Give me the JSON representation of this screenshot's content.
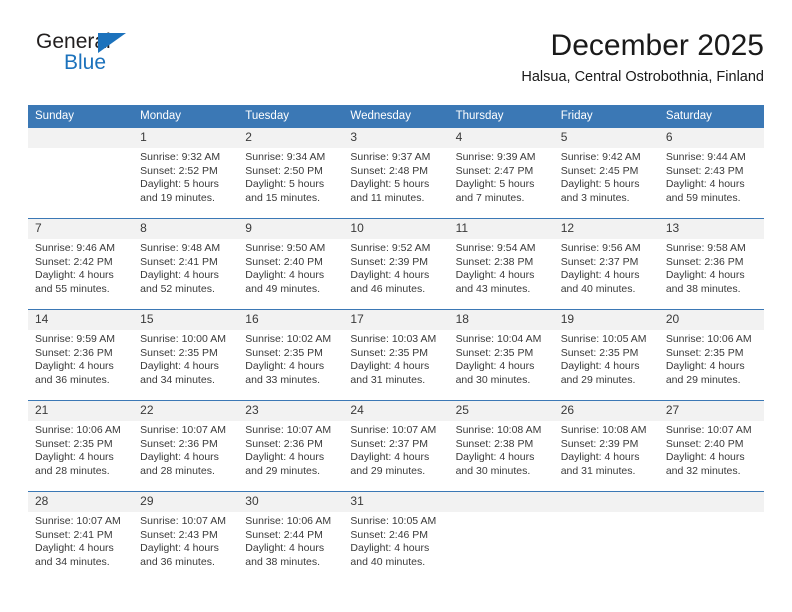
{
  "brand": {
    "name_top": "General",
    "name_bottom": "Blue",
    "triangle_color": "#1c72bc"
  },
  "header": {
    "title": "December 2025",
    "subtitle": "Halsua, Central Ostrobothnia, Finland"
  },
  "theme": {
    "header_bg": "#3b78b5",
    "daynum_bg": "#f2f2f2",
    "text": "#3a3a3a"
  },
  "calendar": {
    "weekday_headers": [
      "Sunday",
      "Monday",
      "Tuesday",
      "Wednesday",
      "Thursday",
      "Friday",
      "Saturday"
    ],
    "weeks": [
      [
        {
          "day": "",
          "lines": []
        },
        {
          "day": "1",
          "lines": [
            "Sunrise: 9:32 AM",
            "Sunset: 2:52 PM",
            "Daylight: 5 hours",
            "and 19 minutes."
          ]
        },
        {
          "day": "2",
          "lines": [
            "Sunrise: 9:34 AM",
            "Sunset: 2:50 PM",
            "Daylight: 5 hours",
            "and 15 minutes."
          ]
        },
        {
          "day": "3",
          "lines": [
            "Sunrise: 9:37 AM",
            "Sunset: 2:48 PM",
            "Daylight: 5 hours",
            "and 11 minutes."
          ]
        },
        {
          "day": "4",
          "lines": [
            "Sunrise: 9:39 AM",
            "Sunset: 2:47 PM",
            "Daylight: 5 hours",
            "and 7 minutes."
          ]
        },
        {
          "day": "5",
          "lines": [
            "Sunrise: 9:42 AM",
            "Sunset: 2:45 PM",
            "Daylight: 5 hours",
            "and 3 minutes."
          ]
        },
        {
          "day": "6",
          "lines": [
            "Sunrise: 9:44 AM",
            "Sunset: 2:43 PM",
            "Daylight: 4 hours",
            "and 59 minutes."
          ]
        }
      ],
      [
        {
          "day": "7",
          "lines": [
            "Sunrise: 9:46 AM",
            "Sunset: 2:42 PM",
            "Daylight: 4 hours",
            "and 55 minutes."
          ]
        },
        {
          "day": "8",
          "lines": [
            "Sunrise: 9:48 AM",
            "Sunset: 2:41 PM",
            "Daylight: 4 hours",
            "and 52 minutes."
          ]
        },
        {
          "day": "9",
          "lines": [
            "Sunrise: 9:50 AM",
            "Sunset: 2:40 PM",
            "Daylight: 4 hours",
            "and 49 minutes."
          ]
        },
        {
          "day": "10",
          "lines": [
            "Sunrise: 9:52 AM",
            "Sunset: 2:39 PM",
            "Daylight: 4 hours",
            "and 46 minutes."
          ]
        },
        {
          "day": "11",
          "lines": [
            "Sunrise: 9:54 AM",
            "Sunset: 2:38 PM",
            "Daylight: 4 hours",
            "and 43 minutes."
          ]
        },
        {
          "day": "12",
          "lines": [
            "Sunrise: 9:56 AM",
            "Sunset: 2:37 PM",
            "Daylight: 4 hours",
            "and 40 minutes."
          ]
        },
        {
          "day": "13",
          "lines": [
            "Sunrise: 9:58 AM",
            "Sunset: 2:36 PM",
            "Daylight: 4 hours",
            "and 38 minutes."
          ]
        }
      ],
      [
        {
          "day": "14",
          "lines": [
            "Sunrise: 9:59 AM",
            "Sunset: 2:36 PM",
            "Daylight: 4 hours",
            "and 36 minutes."
          ]
        },
        {
          "day": "15",
          "lines": [
            "Sunrise: 10:00 AM",
            "Sunset: 2:35 PM",
            "Daylight: 4 hours",
            "and 34 minutes."
          ]
        },
        {
          "day": "16",
          "lines": [
            "Sunrise: 10:02 AM",
            "Sunset: 2:35 PM",
            "Daylight: 4 hours",
            "and 33 minutes."
          ]
        },
        {
          "day": "17",
          "lines": [
            "Sunrise: 10:03 AM",
            "Sunset: 2:35 PM",
            "Daylight: 4 hours",
            "and 31 minutes."
          ]
        },
        {
          "day": "18",
          "lines": [
            "Sunrise: 10:04 AM",
            "Sunset: 2:35 PM",
            "Daylight: 4 hours",
            "and 30 minutes."
          ]
        },
        {
          "day": "19",
          "lines": [
            "Sunrise: 10:05 AM",
            "Sunset: 2:35 PM",
            "Daylight: 4 hours",
            "and 29 minutes."
          ]
        },
        {
          "day": "20",
          "lines": [
            "Sunrise: 10:06 AM",
            "Sunset: 2:35 PM",
            "Daylight: 4 hours",
            "and 29 minutes."
          ]
        }
      ],
      [
        {
          "day": "21",
          "lines": [
            "Sunrise: 10:06 AM",
            "Sunset: 2:35 PM",
            "Daylight: 4 hours",
            "and 28 minutes."
          ]
        },
        {
          "day": "22",
          "lines": [
            "Sunrise: 10:07 AM",
            "Sunset: 2:36 PM",
            "Daylight: 4 hours",
            "and 28 minutes."
          ]
        },
        {
          "day": "23",
          "lines": [
            "Sunrise: 10:07 AM",
            "Sunset: 2:36 PM",
            "Daylight: 4 hours",
            "and 29 minutes."
          ]
        },
        {
          "day": "24",
          "lines": [
            "Sunrise: 10:07 AM",
            "Sunset: 2:37 PM",
            "Daylight: 4 hours",
            "and 29 minutes."
          ]
        },
        {
          "day": "25",
          "lines": [
            "Sunrise: 10:08 AM",
            "Sunset: 2:38 PM",
            "Daylight: 4 hours",
            "and 30 minutes."
          ]
        },
        {
          "day": "26",
          "lines": [
            "Sunrise: 10:08 AM",
            "Sunset: 2:39 PM",
            "Daylight: 4 hours",
            "and 31 minutes."
          ]
        },
        {
          "day": "27",
          "lines": [
            "Sunrise: 10:07 AM",
            "Sunset: 2:40 PM",
            "Daylight: 4 hours",
            "and 32 minutes."
          ]
        }
      ],
      [
        {
          "day": "28",
          "lines": [
            "Sunrise: 10:07 AM",
            "Sunset: 2:41 PM",
            "Daylight: 4 hours",
            "and 34 minutes."
          ]
        },
        {
          "day": "29",
          "lines": [
            "Sunrise: 10:07 AM",
            "Sunset: 2:43 PM",
            "Daylight: 4 hours",
            "and 36 minutes."
          ]
        },
        {
          "day": "30",
          "lines": [
            "Sunrise: 10:06 AM",
            "Sunset: 2:44 PM",
            "Daylight: 4 hours",
            "and 38 minutes."
          ]
        },
        {
          "day": "31",
          "lines": [
            "Sunrise: 10:05 AM",
            "Sunset: 2:46 PM",
            "Daylight: 4 hours",
            "and 40 minutes."
          ]
        },
        {
          "day": "",
          "lines": []
        },
        {
          "day": "",
          "lines": []
        },
        {
          "day": "",
          "lines": []
        }
      ]
    ]
  }
}
